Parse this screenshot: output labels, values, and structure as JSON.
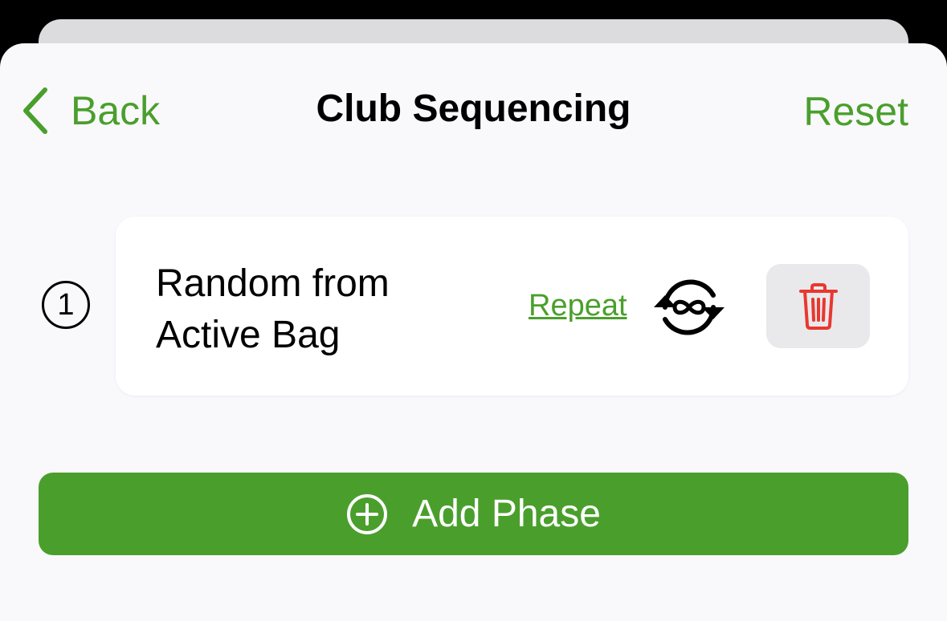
{
  "nav": {
    "back_label": "Back",
    "title": "Club Sequencing",
    "reset_label": "Reset"
  },
  "phases": [
    {
      "number": "1",
      "name": "Random from Active Bag",
      "repeat_label": "Repeat",
      "repeat_icon": "repeat-infinity-icon",
      "delete_icon": "trash-icon"
    }
  ],
  "add_phase": {
    "label": "Add Phase",
    "icon": "plus-circle-icon"
  },
  "colors": {
    "accent": "#4a9f2c",
    "destructive": "#e8382f",
    "background": "#f9f9fc"
  }
}
